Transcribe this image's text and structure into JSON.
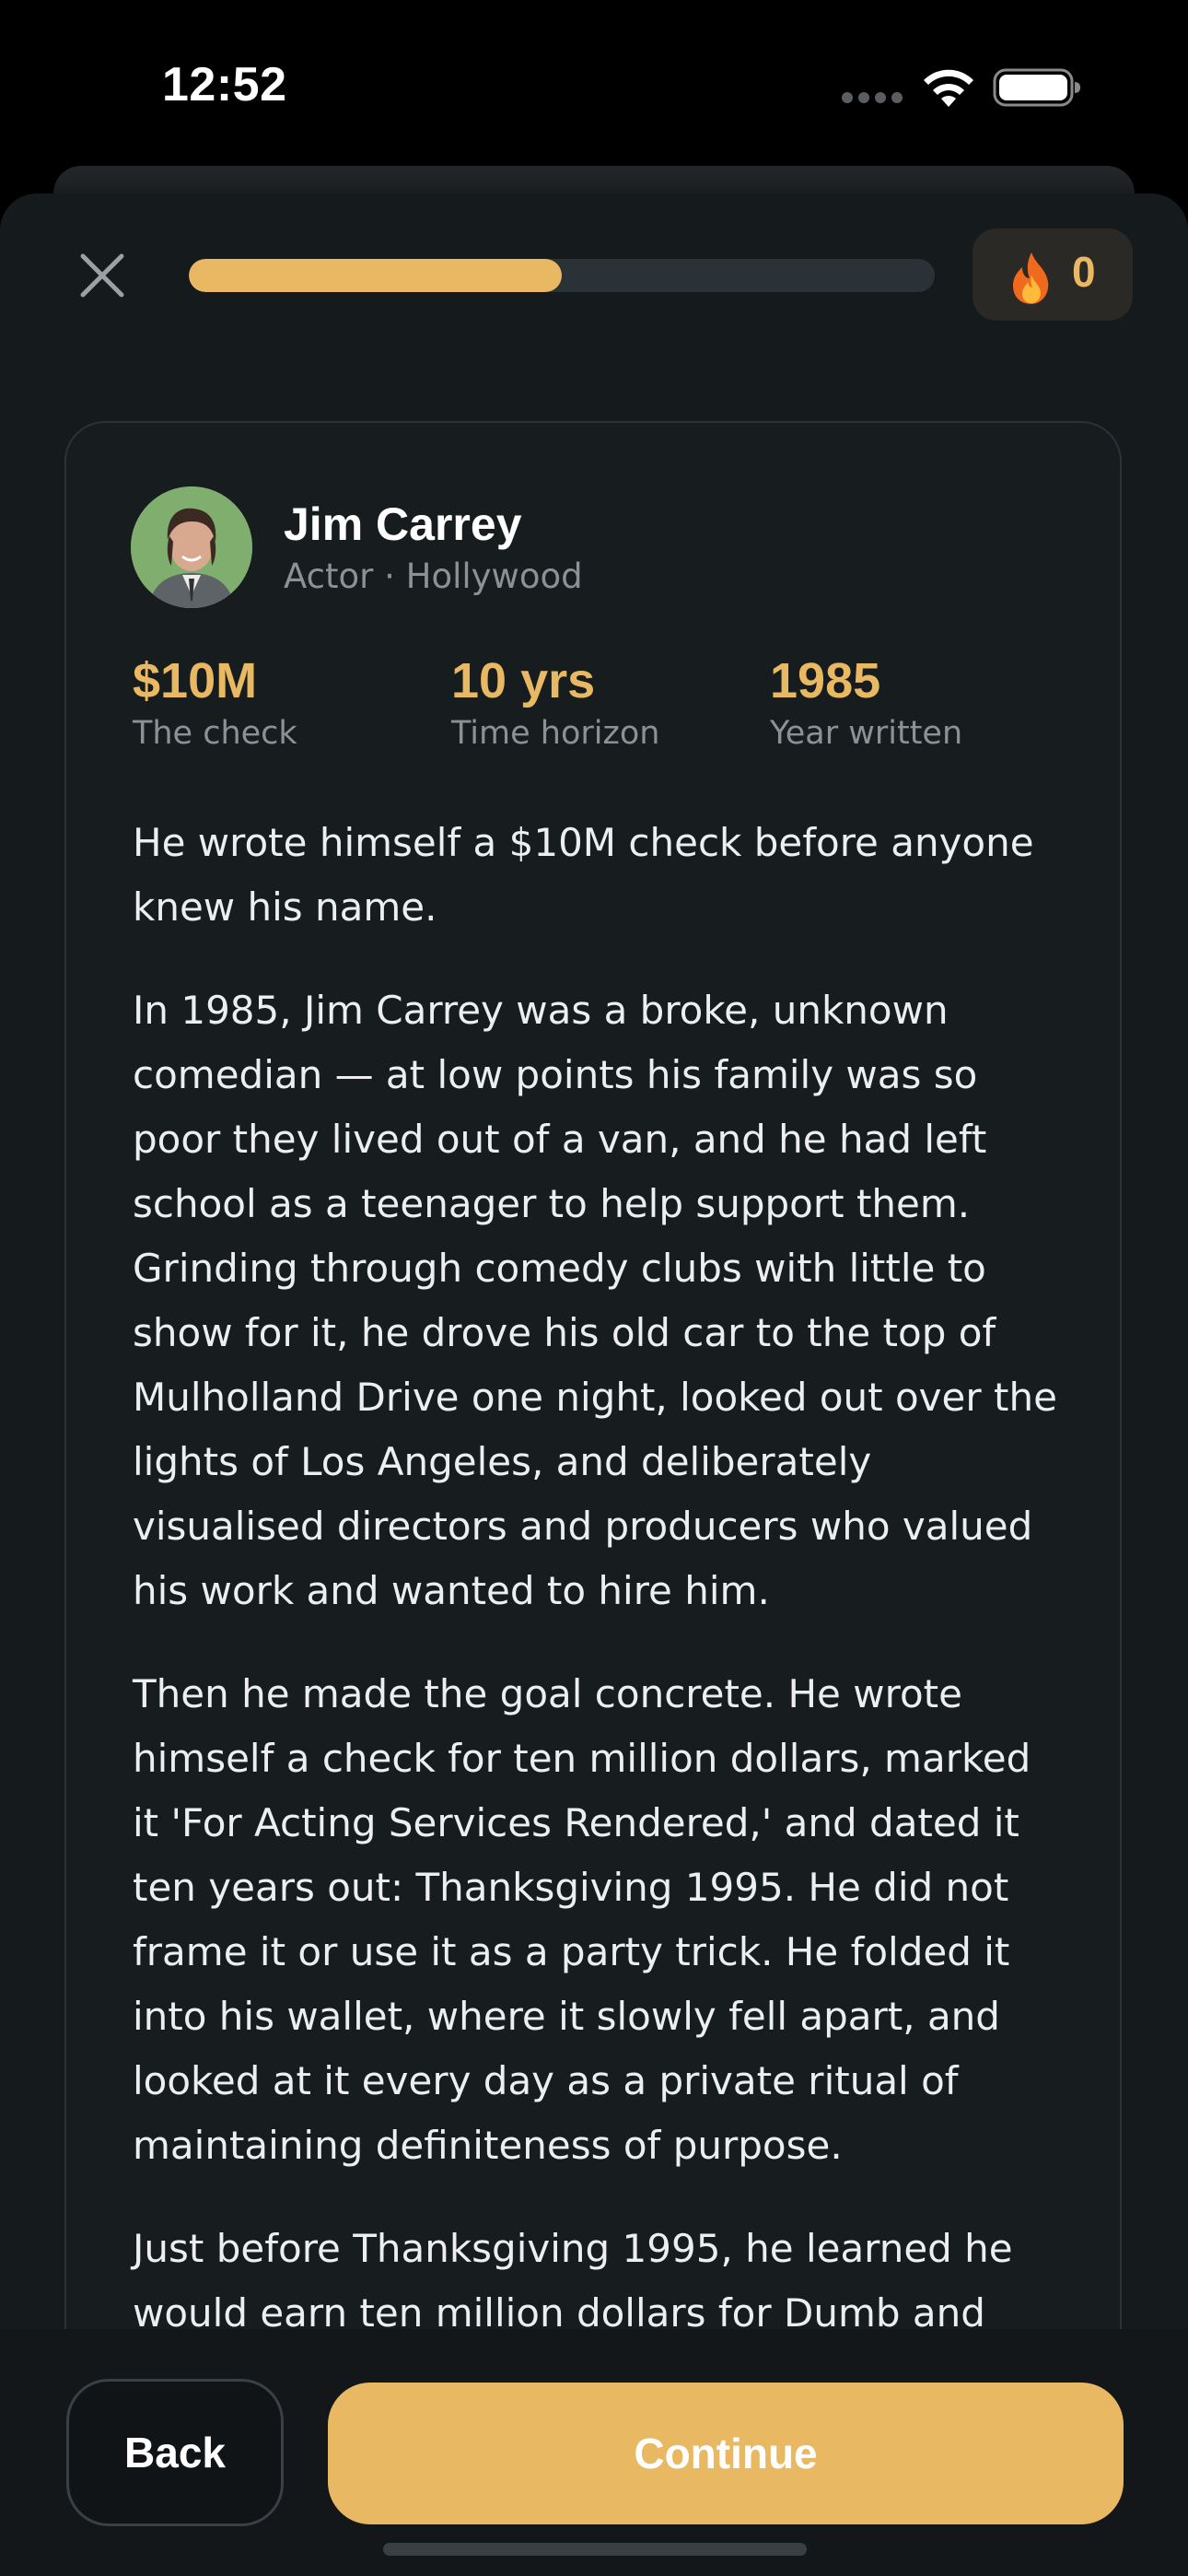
{
  "status_bar": {
    "time": "12:52",
    "icons": [
      "cellular-dots-icon",
      "wifi-icon",
      "battery-icon"
    ]
  },
  "header": {
    "close_icon": "close-icon",
    "progress": 0.5,
    "streak": {
      "icon": "fire-icon",
      "count": "0"
    }
  },
  "card": {
    "person": {
      "name": "Jim Carrey",
      "role": "Actor · Hollywood"
    },
    "stats": [
      {
        "value": "$10M",
        "label": "The check"
      },
      {
        "value": "10 yrs",
        "label": "Time horizon"
      },
      {
        "value": "1985",
        "label": "Year written"
      }
    ],
    "paragraphs": [
      "He wrote himself a $10M check before anyone knew his name.",
      "In 1985, Jim Carrey was a broke, unknown comedian — at low points his family was so poor they lived out of a van, and he had left school as a teenager to help support them. Grinding through comedy clubs with little to show for it, he drove his old car to the top of Mulholland Drive one night, looked out over the lights of Los Angeles, and deliberately visualised directors and producers who valued his work and wanted to hire him.",
      "Then he made the goal concrete. He wrote himself a check for ten million dollars, marked it 'For Acting Services Rendered,' and dated it ten years out: Thanksgiving 1995. He did not frame it or use it as a party trick. He folded it into his wallet, where it slowly fell apart, and looked at it every day as a private ritual of maintaining definiteness of purpose.",
      "Just before Thanksgiving 1995, he learned he would earn ten million dollars for Dumb and"
    ]
  },
  "footer": {
    "back_label": "Back",
    "continue_label": "Continue"
  },
  "colors": {
    "accent": "#E8B862",
    "background": "#151A1C",
    "card": "#171D1F",
    "muted_text": "#8B9296"
  }
}
